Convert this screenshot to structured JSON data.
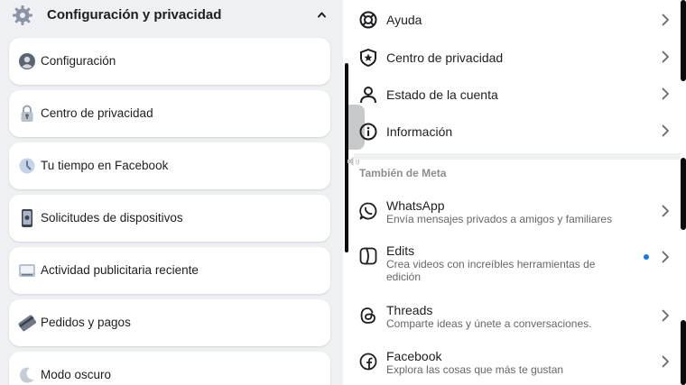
{
  "left": {
    "header": {
      "title": "Configuración y privacidad",
      "icon": "gear-icon"
    },
    "items": [
      {
        "label": "Configuración",
        "icon": "account-icon"
      },
      {
        "label": "Centro de privacidad",
        "icon": "lock-icon"
      },
      {
        "label": "Tu tiempo en Facebook",
        "icon": "clock-icon"
      },
      {
        "label": "Solicitudes de dispositivos",
        "icon": "device-icon"
      },
      {
        "label": "Actividad publicitaria reciente",
        "icon": "ad-icon"
      },
      {
        "label": "Pedidos y pagos",
        "icon": "payment-card-icon"
      },
      {
        "label": "Modo oscuro",
        "icon": "moon-icon"
      }
    ]
  },
  "right": {
    "menu": [
      {
        "label": "Ayuda",
        "icon": "lifebuoy-icon"
      },
      {
        "label": "Centro de privacidad",
        "icon": "shield-star-icon"
      },
      {
        "label": "Estado de la cuenta",
        "icon": "person-icon"
      },
      {
        "label": "Información",
        "icon": "info-icon"
      }
    ],
    "section_label": "También de Meta",
    "apps": [
      {
        "title": "WhatsApp",
        "subtitle": "Envía mensajes privados a amigos y familiares",
        "icon": "whatsapp-icon"
      },
      {
        "title": "Edits",
        "subtitle": "Crea videos con increíbles herramientas de edición",
        "icon": "edits-icon",
        "badge": "new-dot"
      },
      {
        "title": "Threads",
        "subtitle": "Comparte ideas y únete a conversaciones.",
        "icon": "threads-icon"
      },
      {
        "title": "Facebook",
        "subtitle": "Explora las cosas que más te gustan",
        "icon": "facebook-icon"
      }
    ]
  },
  "colors": {
    "accent": "#1877f2",
    "panel_bg": "#eef0f3",
    "subtext": "#65676b"
  }
}
